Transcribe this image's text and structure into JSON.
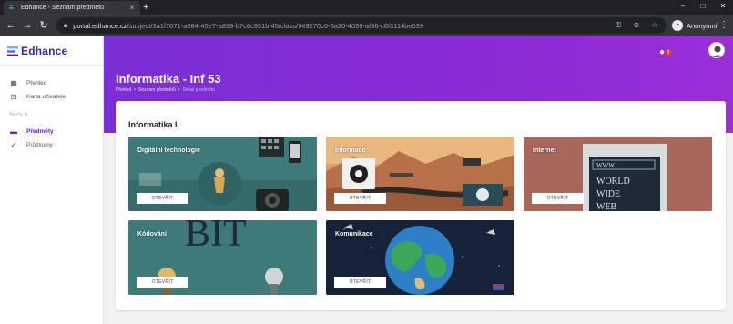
{
  "browser": {
    "tab_title": "Edhance - Seznam předmětů",
    "url_domain": "portal.edhance.cz",
    "url_path": "/subject/3a1f7071-a084-45e7-a838-b7c6c951bf45/class/949270c0-6a30-4099-af36-c6f3114be039",
    "profile_label": "Anonymní",
    "new_tab": "+",
    "minimize": "–",
    "maximize": "□",
    "close": "✕",
    "tab_close": "×"
  },
  "app": {
    "brand": "Edhance",
    "nav": [
      {
        "label": "Přehled"
      },
      {
        "label": "Karta uživatele"
      }
    ],
    "section_label": "ŠKOLA",
    "school_nav": [
      {
        "label": "Předměty"
      },
      {
        "label": "Průzkumy"
      }
    ],
    "notification_count": "3"
  },
  "page": {
    "title": "Informatika - Inf 53",
    "breadcrumb": [
      "Přehled",
      "Seznam předmětů",
      "Detail předmětu"
    ],
    "breadcrumb_sep": "•",
    "panel_title": "Informatika I.",
    "open_label": "OTEVŘÍT",
    "cards": [
      {
        "name": "Digitální technologie"
      },
      {
        "name": "Informace"
      },
      {
        "name": "Internet"
      },
      {
        "name": "Kódování"
      },
      {
        "name": "Komunikace"
      }
    ],
    "art_text": {
      "internet_lines": [
        "WWW",
        "WORLD",
        "WIDE",
        "WEB"
      ],
      "bit": "BIT"
    }
  },
  "colors": {
    "accent": "#6a1fc2",
    "hero": "#8a2bd6",
    "card_teal": "#3f7a7a",
    "card_desert": "#c98a5a",
    "card_brick": "#a9665a",
    "card_navy": "#16223a"
  }
}
